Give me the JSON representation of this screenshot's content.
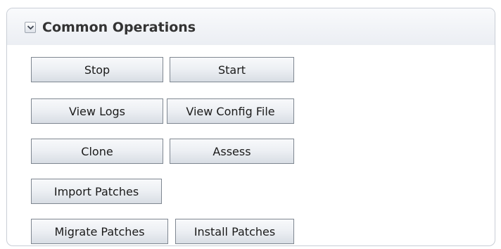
{
  "panel": {
    "title": "Common Operations",
    "toggle_icon": "chevron-down-icon"
  },
  "buttons": {
    "stop": "Stop",
    "start": "Start",
    "view_logs": "View Logs",
    "view_config_file": "View Config File",
    "clone": "Clone",
    "assess": "Assess",
    "import_patches": "Import Patches",
    "migrate_patches": "Migrate Patches",
    "install_patches": "Install Patches"
  }
}
